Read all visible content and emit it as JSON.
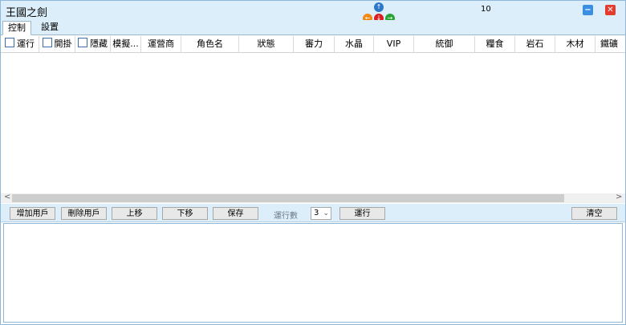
{
  "window": {
    "title": "王國之劍",
    "count": "10",
    "minimize_glyph": "−",
    "close_glyph": "✕"
  },
  "nav_arrows": {
    "up": "↑",
    "left": "←",
    "down": "↓",
    "right": "→"
  },
  "tabs": [
    {
      "label": "控制"
    },
    {
      "label": "設置"
    }
  ],
  "columns": [
    {
      "label": "運行"
    },
    {
      "label": "開掛"
    },
    {
      "label": "隱藏"
    },
    {
      "label": "模擬..."
    },
    {
      "label": "運營商"
    },
    {
      "label": "角色名"
    },
    {
      "label": "狀態"
    },
    {
      "label": "審力"
    },
    {
      "label": "水晶"
    },
    {
      "label": "VIP"
    },
    {
      "label": "統御"
    },
    {
      "label": "糧食"
    },
    {
      "label": "岩石"
    },
    {
      "label": "木材"
    },
    {
      "label": "鐵礦"
    }
  ],
  "scroll": {
    "left": "<",
    "right": ">"
  },
  "toolbar": {
    "add_user": "增加用戶",
    "delete_user": "刪除用戶",
    "move_up": "上移",
    "move_down": "下移",
    "save": "保存",
    "run_count_label": "運行數",
    "run_count_value": "3",
    "run": "運行",
    "clear": "清空"
  },
  "icons": {
    "checkbox": "checkbox-icon",
    "arrow_up": "arrow-up-icon",
    "arrow_down": "arrow-down-icon",
    "arrow_left": "arrow-left-icon",
    "arrow_right": "arrow-right-icon",
    "minimize": "minimize-icon",
    "close": "close-icon"
  },
  "colors": {
    "titlebar": "#dceefa",
    "minimize": "#3b8fe0",
    "close": "#e33b2e",
    "arrow_up": "#2f78c8",
    "arrow_left": "#f08a14",
    "arrow_down": "#d81e1e",
    "arrow_right": "#2aa336"
  }
}
